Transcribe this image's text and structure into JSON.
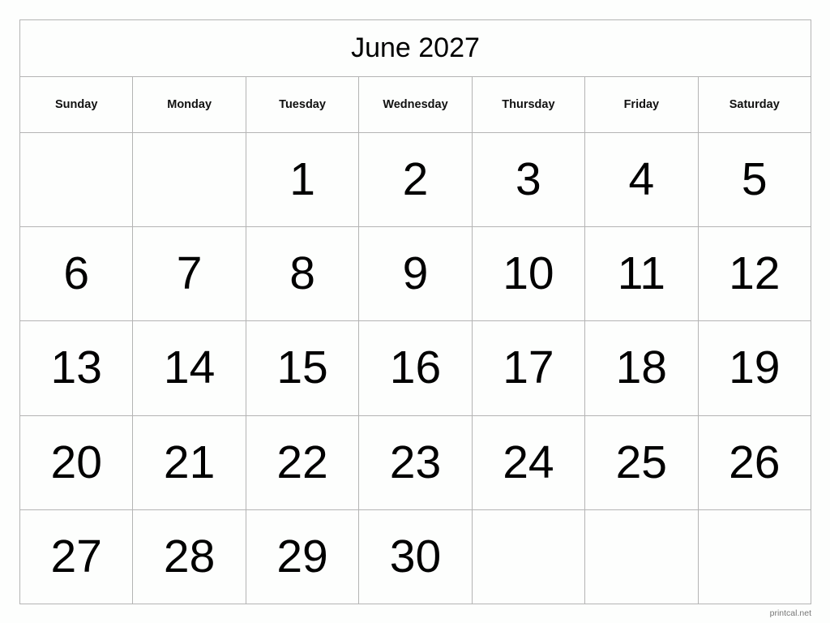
{
  "calendar": {
    "title": "June 2027",
    "weekdays": [
      "Sunday",
      "Monday",
      "Tuesday",
      "Wednesday",
      "Thursday",
      "Friday",
      "Saturday"
    ],
    "weeks": [
      [
        "",
        "",
        "1",
        "2",
        "3",
        "4",
        "5"
      ],
      [
        "6",
        "7",
        "8",
        "9",
        "10",
        "11",
        "12"
      ],
      [
        "13",
        "14",
        "15",
        "16",
        "17",
        "18",
        "19"
      ],
      [
        "20",
        "21",
        "22",
        "23",
        "24",
        "25",
        "26"
      ],
      [
        "27",
        "28",
        "29",
        "30",
        "",
        "",
        ""
      ]
    ]
  },
  "footer": {
    "source": "printcal.net"
  }
}
